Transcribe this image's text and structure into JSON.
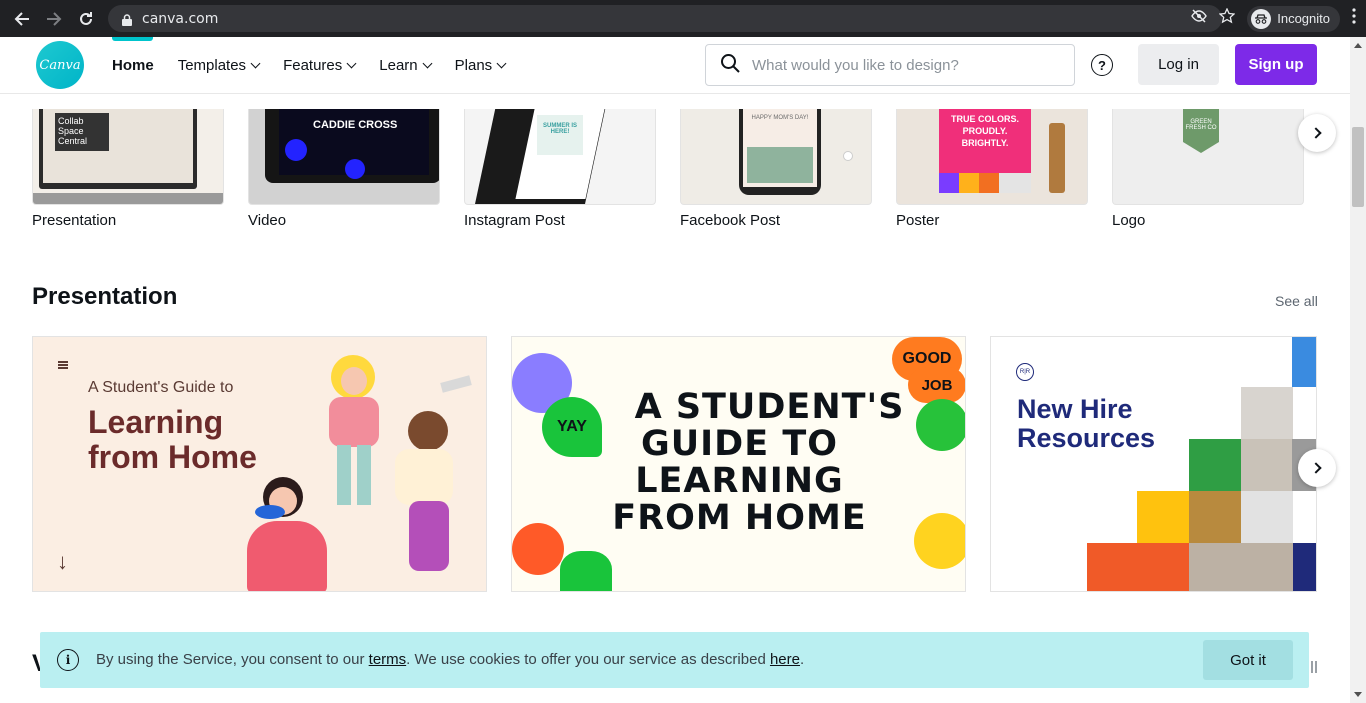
{
  "browser": {
    "url": "canva.com",
    "incognito_label": "Incognito"
  },
  "header": {
    "logo_text": "Canva",
    "menu": [
      {
        "label": "Home"
      },
      {
        "label": "Templates"
      },
      {
        "label": "Features"
      },
      {
        "label": "Learn"
      },
      {
        "label": "Plans"
      }
    ],
    "search_placeholder": "What would you like to design?",
    "help_label": "?",
    "login_label": "Log in",
    "signup_label": "Sign up",
    "accent_color": "#00c4cc",
    "signup_color": "#7d2ae8"
  },
  "design_types": [
    {
      "label": "Presentation",
      "thumb_text": "Collab Space Central"
    },
    {
      "label": "Video",
      "thumb_text": "CADDIE CROSS"
    },
    {
      "label": "Instagram Post",
      "thumb_text": "SUMMER IS HERE!"
    },
    {
      "label": "Facebook Post",
      "thumb_text": "HAPPY MOM'S DAY!"
    },
    {
      "label": "Poster",
      "thumb_text": "TRUE COLORS. PROUDLY. BRIGHTLY."
    },
    {
      "label": "Logo",
      "thumb_text": "GREEN FRESH CO"
    }
  ],
  "presentation_section": {
    "title": "Presentation",
    "see_all": "See all",
    "cards": [
      {
        "subtitle": "A Student's Guide to",
        "title_line1": "Learning",
        "title_line2": "from Home"
      },
      {
        "lines": [
          "A STUDENT'S",
          "GUIDE TO",
          "LEARNING",
          "FROM HOME"
        ],
        "stickers": [
          "YAY",
          "GOOD",
          "JOB"
        ]
      },
      {
        "logo": "R|R",
        "title_line1": "New Hire",
        "title_line2": "Resources"
      }
    ]
  },
  "cookie_banner": {
    "text_before": "By using the Service, you consent to our ",
    "terms_link": "terms",
    "text_middle": ". We use cookies to offer you our service as described ",
    "here_link": "here",
    "text_after": ".",
    "button_label": "Got it"
  }
}
